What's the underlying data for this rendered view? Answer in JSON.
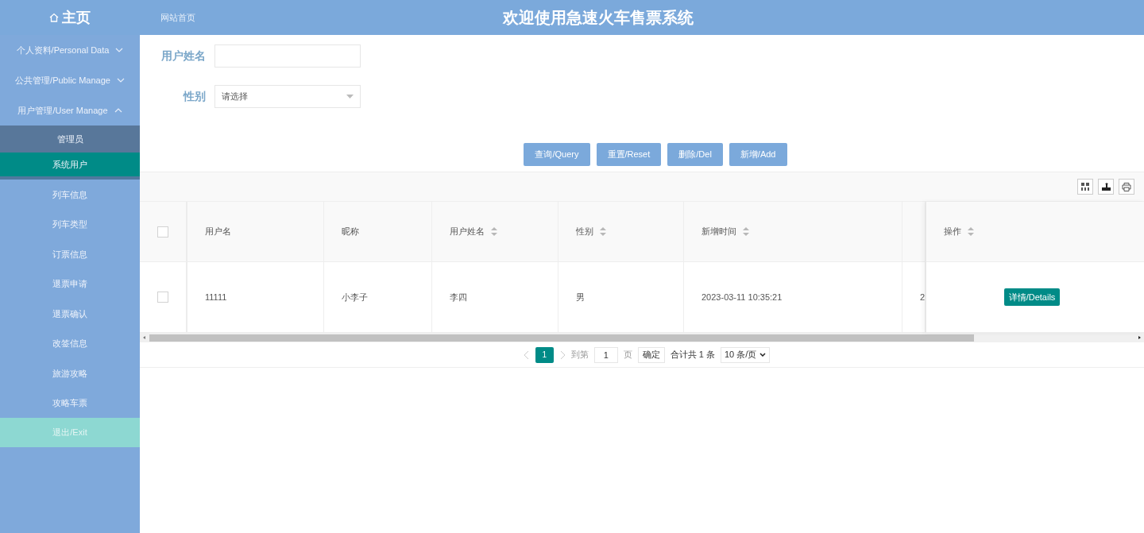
{
  "header": {
    "home": "主页",
    "breadcrumb": "网站首页",
    "title": "欢迎使用急速火车售票系统"
  },
  "sidebar": {
    "items": [
      {
        "kind": "group",
        "label": "个人资料/Personal Data",
        "expanded": false
      },
      {
        "kind": "group",
        "label": "公共管理/Public Manage",
        "expanded": false
      },
      {
        "kind": "group",
        "label": "用户管理/User Manage",
        "expanded": true,
        "children": [
          {
            "label": "管理员",
            "selected": false
          },
          {
            "label": "系统用户",
            "selected": true
          }
        ]
      },
      {
        "kind": "link",
        "label": "列车信息"
      },
      {
        "kind": "link",
        "label": "列车类型"
      },
      {
        "kind": "link",
        "label": "订票信息"
      },
      {
        "kind": "link",
        "label": "退票申请"
      },
      {
        "kind": "link",
        "label": "退票确认"
      },
      {
        "kind": "link",
        "label": "改签信息"
      },
      {
        "kind": "link",
        "label": "旅游攻略"
      },
      {
        "kind": "link",
        "label": "攻略车票"
      },
      {
        "kind": "exit",
        "label": "退出/Exit"
      }
    ]
  },
  "filters": [
    {
      "kind": "text",
      "label": "用户姓名"
    },
    {
      "kind": "select",
      "label": "性别",
      "placeholder": "请选择"
    }
  ],
  "actions": [
    "查询/Query",
    "重置/Reset",
    "删除/Del",
    "新增/Add"
  ],
  "table": {
    "columns": [
      {
        "label": "用户名",
        "sortable": false
      },
      {
        "label": "昵称",
        "sortable": false
      },
      {
        "label": "用户姓名",
        "sortable": true
      },
      {
        "label": "性别",
        "sortable": true
      },
      {
        "label": "新增时间",
        "sortable": true
      }
    ],
    "select_all_checked": false,
    "action_column": {
      "label": "操作",
      "sortable": true
    },
    "rows": [
      {
        "checked": false,
        "cells": [
          "11111",
          "小李子",
          "李四",
          "男",
          "2023-03-11 10:35:21",
          "2"
        ],
        "action": "详情/Details"
      }
    ]
  },
  "pagination": {
    "pages": [
      {
        "label": "1",
        "selected": true
      }
    ],
    "goto_label": "到第",
    "goto_value": "1",
    "page_unit": "页",
    "confirm": "确定",
    "total": "合计共 1 条",
    "page_size": "10 条/页"
  }
}
